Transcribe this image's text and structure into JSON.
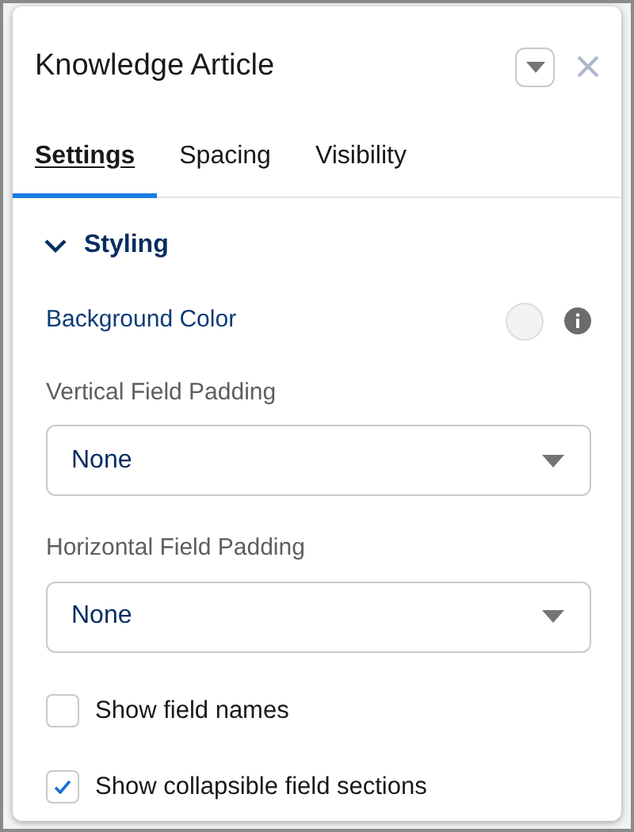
{
  "panel": {
    "title": "Knowledge Article"
  },
  "tabs": [
    {
      "label": "Settings",
      "selected": true
    },
    {
      "label": "Spacing",
      "selected": false
    },
    {
      "label": "Visibility",
      "selected": false
    }
  ],
  "section": {
    "title": "Styling",
    "expanded": true
  },
  "background_color": {
    "label": "Background Color",
    "color": "#f3f2f2"
  },
  "selects": [
    {
      "label": "Vertical Field Padding",
      "value": "None"
    },
    {
      "label": "Horizontal Field Padding",
      "value": "None"
    }
  ],
  "checkboxes": [
    {
      "label": "Show field names",
      "checked": false
    },
    {
      "label": "Show collapsible field sections",
      "checked": true
    }
  ]
}
